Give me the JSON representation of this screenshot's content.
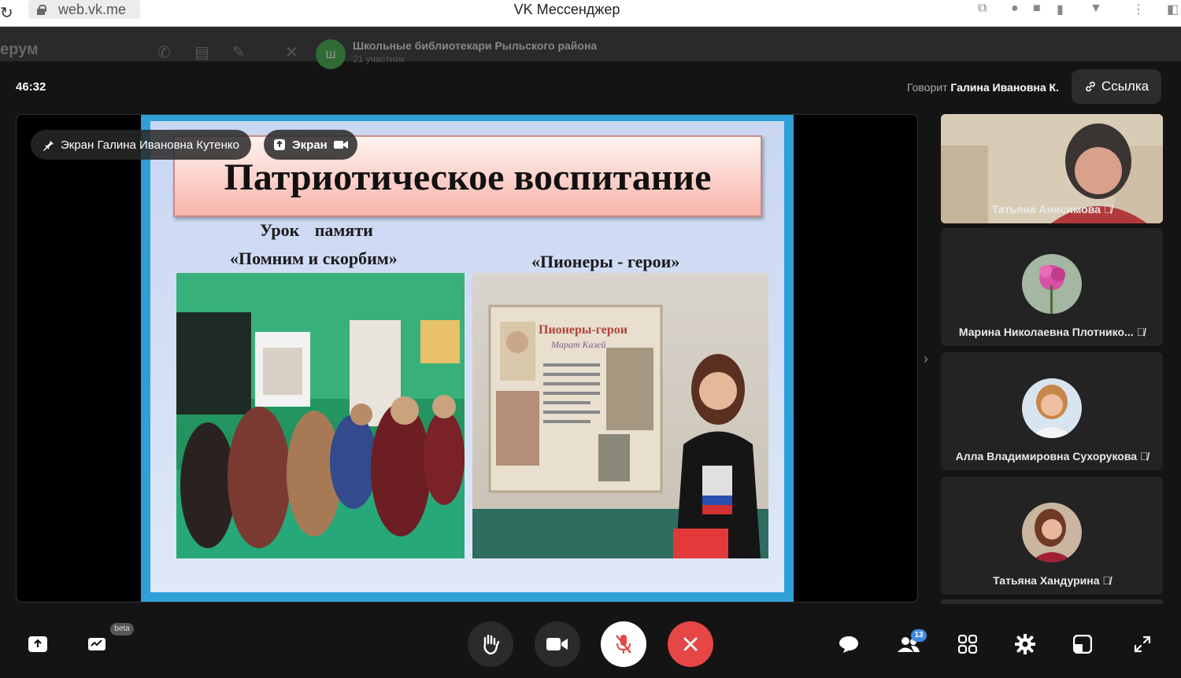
{
  "browser": {
    "url": "web.vk.me",
    "title": "VK Мессенджер"
  },
  "app": {
    "brand": "ерум",
    "chat_avatar_letter": "Ш",
    "chat_title": "Школьные библиотекари Рыльского района",
    "chat_subtitle": "21 участник"
  },
  "call": {
    "timer": "46:32",
    "speaking_label": "Говорит",
    "speaking_name": "Галина Ивановна К.",
    "link_label": "Ссылка",
    "share_chip": "Экран Галина Ивановна Кутенко",
    "screen_chip": "Экран"
  },
  "slide": {
    "title": "Патриотическое воспитание",
    "caption_left_1": "Урок памяти",
    "caption_left_2": "«Помним и скорбим»",
    "caption_right": "«Пионеры - герои»",
    "poster_title": "Пионеры-герои",
    "poster_subtitle": "Марат Казей"
  },
  "participants": [
    {
      "name": "Татьяна Анисимова"
    },
    {
      "name": "Марина Николаевна Плотнико..."
    },
    {
      "name": "Алла Владимировна Сухорукова"
    },
    {
      "name": "Татьяна Хандурина"
    }
  ],
  "toolbar": {
    "beta": "beta",
    "participants_count": "13"
  },
  "colors": {
    "end_call": "#e64646",
    "badge": "#3f8ae0",
    "slide_border": "#2f9fd8"
  }
}
